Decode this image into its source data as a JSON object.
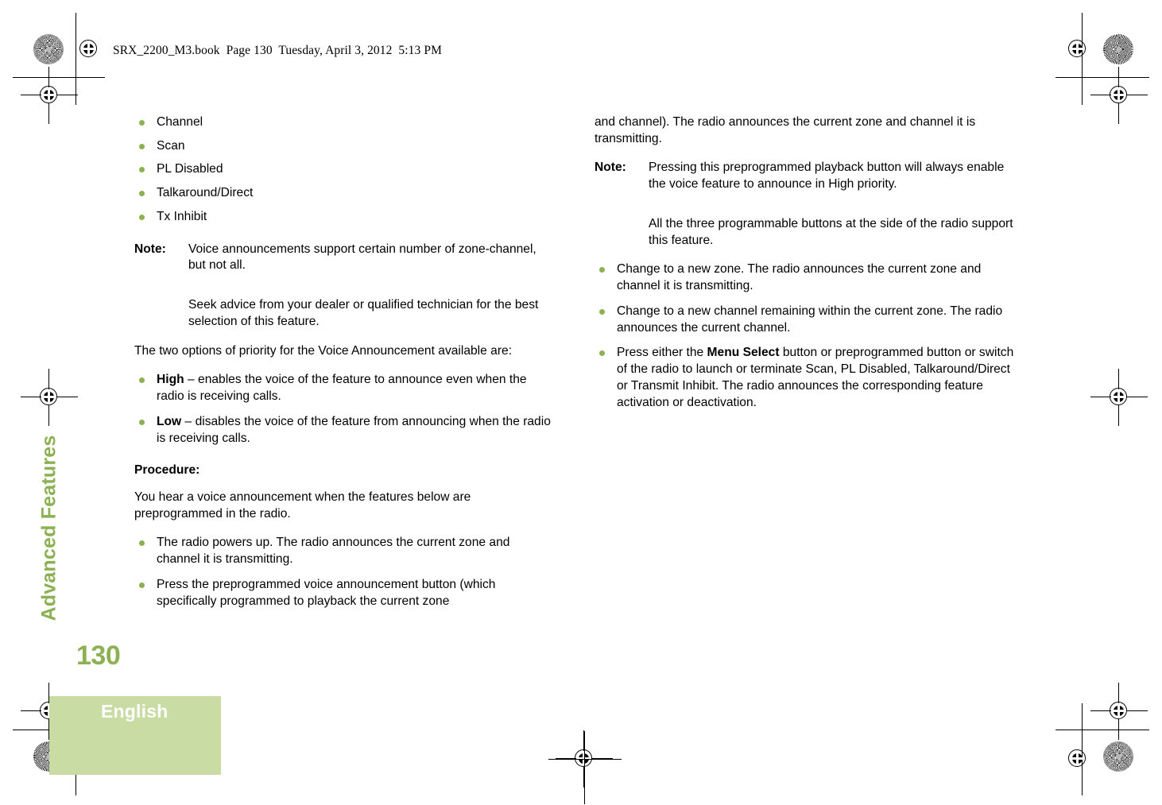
{
  "header": {
    "slug": "SRX_2200_M3.book  Page 130  Tuesday, April 3, 2012  5:13 PM"
  },
  "sidebar": {
    "chapter_title": "Advanced Features",
    "page_number": "130",
    "language": "English"
  },
  "colors": {
    "accent_green": "#8CB152",
    "tab_background": "#C8DCA4",
    "text": "#000000"
  },
  "left_column": {
    "feature_bullets": [
      "Channel",
      "Scan",
      "PL Disabled",
      "Talkaround/Direct",
      "Tx Inhibit"
    ],
    "note_1": {
      "label": "Note:",
      "body": "Voice announcements support certain number of zone-channel, but not all.",
      "continuation": "Seek advice from your dealer or qualified technician for the best selection of this feature."
    },
    "priority_intro": "The two options of priority for the Voice Announcement available are:",
    "priority_options": [
      {
        "term": "High",
        "dash": "–",
        "description": "enables the voice of the feature to announce even when the radio is receiving calls."
      },
      {
        "term": "Low",
        "dash": "–",
        "description": "disables the voice of the feature from announcing when the radio is receiving calls."
      }
    ],
    "procedure_heading": "Procedure:",
    "procedure_intro": "You hear a voice announcement when the features below are preprogrammed in the radio.",
    "procedure_bullets": [
      "The radio powers up. The radio announces the current zone and channel it is transmitting.",
      "Press the preprogrammed voice announcement button (which specifically programmed to playback the current zone"
    ]
  },
  "right_column": {
    "continued_text": "and channel). The radio announces the current zone and channel it is transmitting.",
    "note_2": {
      "label": "Note:",
      "body": "Pressing this preprogrammed playback button will always enable the voice feature to announce in High priority.",
      "continuation": "All the three programmable buttons at the side of the radio support this feature."
    },
    "procedure_bullets": [
      {
        "pre": "Change to a new zone. The radio announces the current zone and channel it is transmitting.",
        "bold": "",
        "post": ""
      },
      {
        "pre": "Change to a new channel remaining within the current zone. The radio announces the current channel.",
        "bold": "",
        "post": ""
      },
      {
        "pre": "Press either the ",
        "bold": "Menu Select",
        "post": " button or preprogrammed button or switch of the radio to launch or terminate Scan, PL Disabled, Talkaround/Direct or Transmit Inhibit. The radio announces the corresponding feature activation or deactivation."
      }
    ]
  }
}
